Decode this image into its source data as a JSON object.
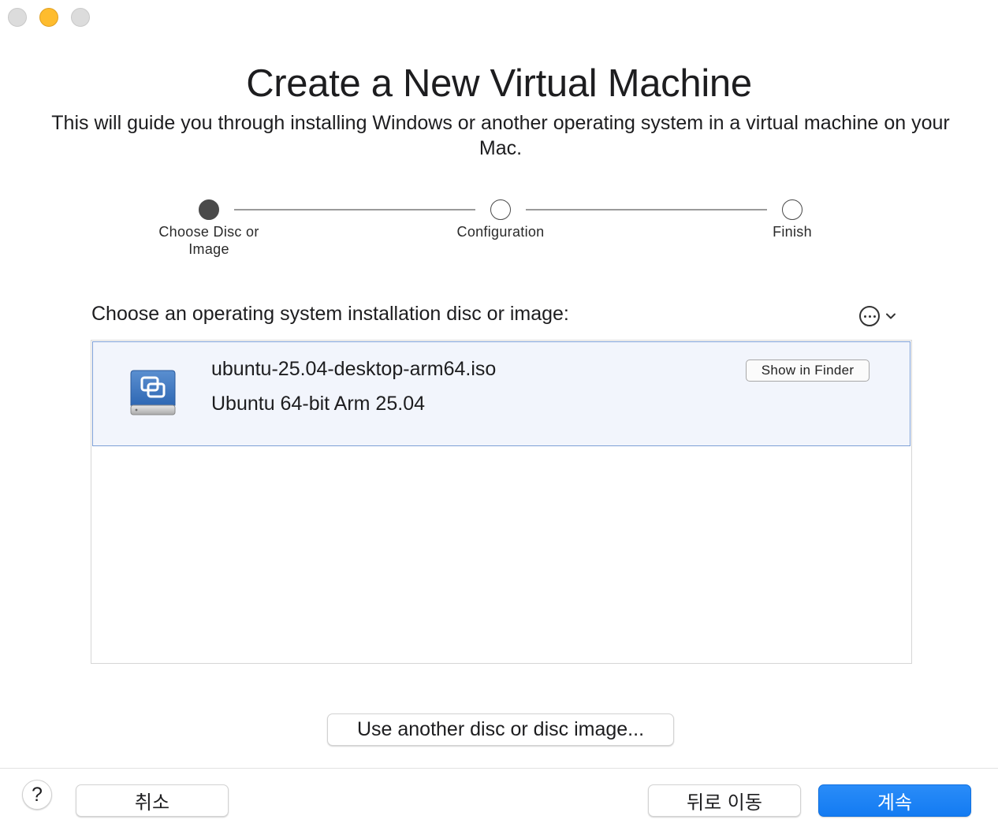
{
  "window": {
    "title": "Create a New Virtual Machine",
    "subtitle": "This will guide you through installing Windows or another operating system in a virtual machine on your Mac."
  },
  "stepper": {
    "steps": [
      {
        "label": "Choose Disc or Image",
        "state": "active"
      },
      {
        "label": "Configuration",
        "state": "pending"
      },
      {
        "label": "Finish",
        "state": "pending"
      }
    ]
  },
  "chooser": {
    "label": "Choose an operating system installation disc or image:",
    "more_icon": "ellipsis-circle-icon",
    "items": [
      {
        "icon": "disk-image-icon",
        "name": "ubuntu-25.04-desktop-arm64.iso",
        "description": "Ubuntu 64-bit Arm 25.04",
        "show_in_finder_label": "Show in Finder",
        "selected": true
      }
    ]
  },
  "actions": {
    "use_another_label": "Use another disc or disc image...",
    "help_label": "?",
    "cancel_label": "취소",
    "back_label": "뒤로 이동",
    "continue_label": "계속"
  },
  "colors": {
    "accent": "#137bf2",
    "selection_bg": "#f2f5fc",
    "selection_border": "#7d9fd6",
    "minimize": "#febc2e"
  }
}
